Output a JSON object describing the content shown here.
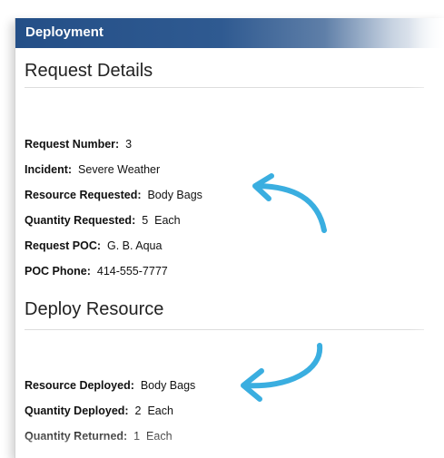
{
  "header": {
    "title": "Deployment"
  },
  "request_details": {
    "heading": "Request Details",
    "fields": [
      {
        "label": "Request Number:",
        "value": "3"
      },
      {
        "label": "Incident:",
        "value": "Severe Weather"
      },
      {
        "label": "Resource Requested:",
        "value": "Body Bags"
      },
      {
        "label": "Quantity Requested:",
        "value": "5  Each"
      },
      {
        "label": "Request POC:",
        "value": "G. B. Aqua"
      },
      {
        "label": "POC Phone:",
        "value": "414-555-7777"
      }
    ]
  },
  "deploy_resource": {
    "heading": "Deploy Resource",
    "fields": [
      {
        "label": "Resource Deployed:",
        "value": "Body Bags"
      },
      {
        "label": "Quantity Deployed:",
        "value": "2  Each"
      },
      {
        "label": "Quantity Returned:",
        "value": "1  Each"
      }
    ]
  },
  "annotations": {
    "arrow_color": "#3aaee0"
  }
}
